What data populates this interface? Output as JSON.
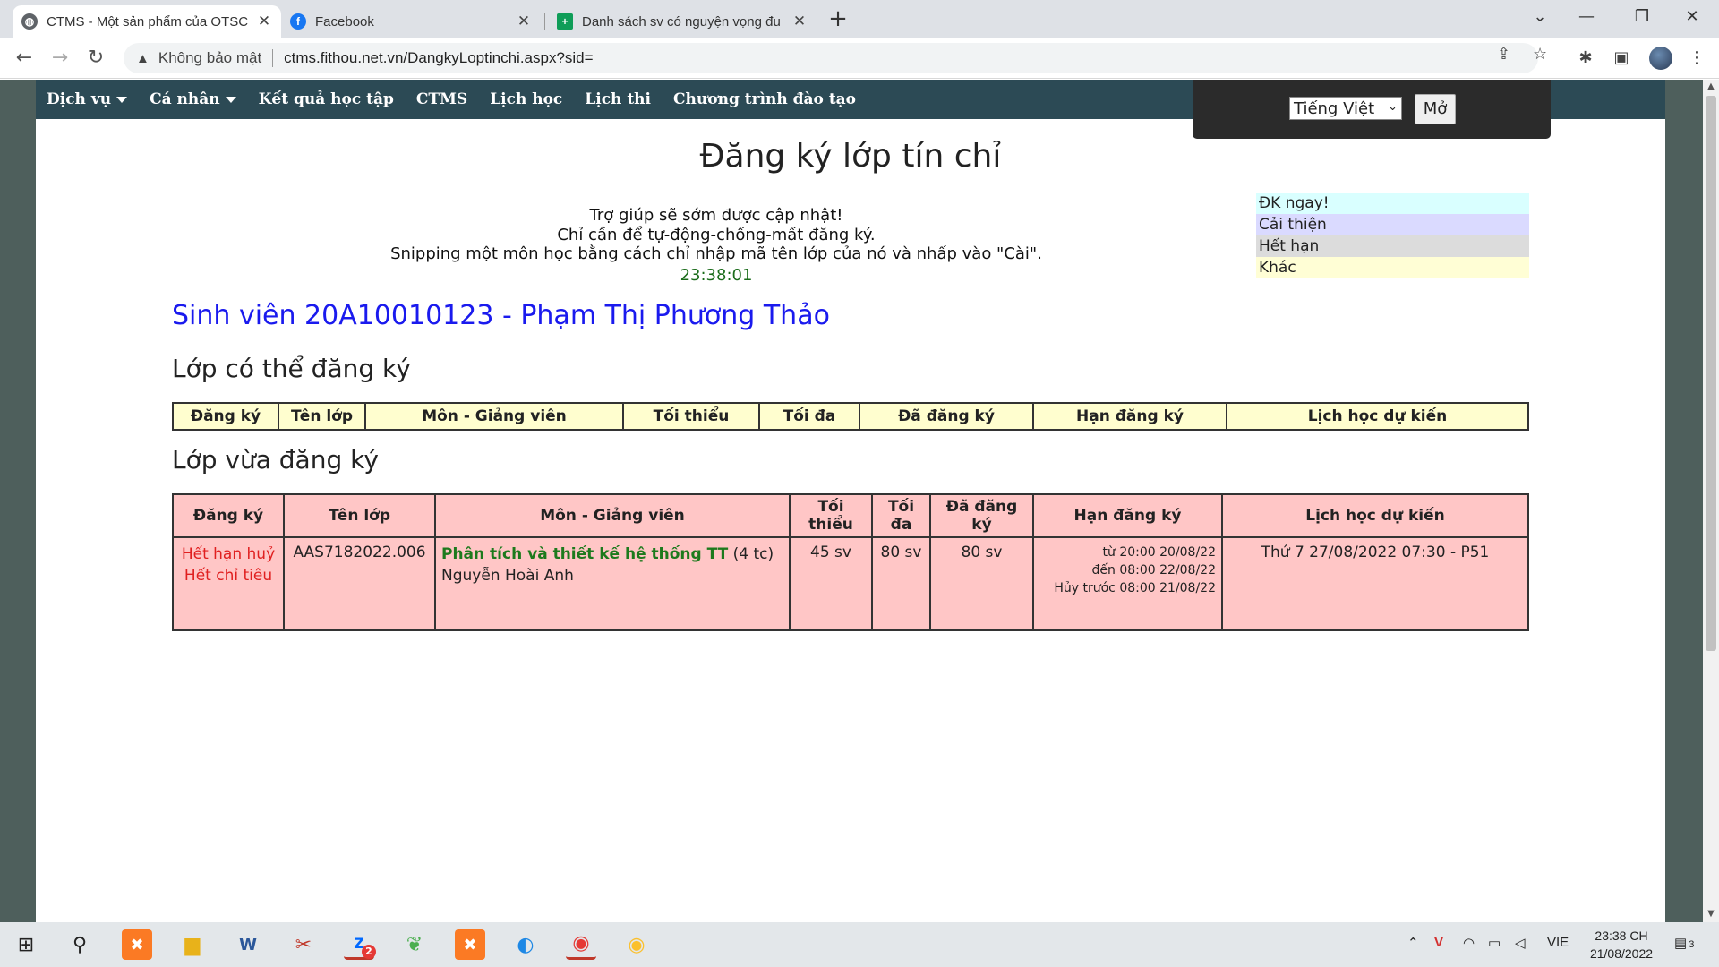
{
  "browser": {
    "tabs": [
      {
        "title": "CTMS - Một sản phẩm của OTSC",
        "icon": "globe-icon"
      },
      {
        "title": "Facebook",
        "icon": "facebook-icon"
      },
      {
        "title": "Danh sách sv có nguyện vọng đu",
        "icon": "sheets-icon"
      }
    ],
    "new_tab": "+",
    "address": {
      "security_label": "Không bảo mật",
      "url": "ctms.fithou.net.vn/DangkyLoptinchi.aspx?sid="
    }
  },
  "nav": {
    "items": [
      {
        "label": "Dịch vụ",
        "dropdown": true
      },
      {
        "label": "Cá nhân",
        "dropdown": true
      },
      {
        "label": "Kết quả học tập"
      },
      {
        "label": "CTMS"
      },
      {
        "label": "Lịch học"
      },
      {
        "label": "Lịch thi"
      },
      {
        "label": "Chương trình đào tạo"
      }
    ],
    "language": {
      "selected": "Tiếng Việt",
      "button": "Mở"
    }
  },
  "page": {
    "title": "Đăng ký lớp tín chỉ",
    "help": [
      "Trợ giúp sẽ sớm được cập nhật!",
      "Chỉ cần để tự-động-chống-mất đăng ký.",
      "Snipping một môn học bằng cách chỉ nhập mã tên lớp của nó và nhấp vào \"Cài\"."
    ],
    "clock": "23:38:01",
    "legend": [
      {
        "label": "ĐK ngay!",
        "color": "#d9ffff"
      },
      {
        "label": "Cải thiện",
        "color": "#dadaff"
      },
      {
        "label": "Hết hạn",
        "color": "#dcdcdc"
      },
      {
        "label": "Khác",
        "color": "#fffed5"
      }
    ],
    "student": "Sinh viên 20A10010123 - Phạm Thị Phương Thảo",
    "available_title": "Lớp có thể đăng ký",
    "registered_title": "Lớp vừa đăng ký"
  },
  "available_table": {
    "headers": [
      "Đăng ký",
      "Tên lớp",
      "Môn - Giảng viên",
      "Tối thiểu",
      "Tối đa",
      "Đã đăng ký",
      "Hạn đăng ký",
      "Lịch học dự kiến"
    ]
  },
  "registered_table": {
    "headers": [
      "Đăng ký",
      "Tên lớp",
      "Môn - Giảng viên",
      "Tối thiểu",
      "Tối đa",
      "Đã đăng ký",
      "Hạn đăng ký",
      "Lịch học dự kiến"
    ],
    "rows": [
      {
        "status1": "Hết hạn huỷ",
        "status2": "Hết chỉ tiêu",
        "class_name": "AAS7182022.006",
        "subject": "Phân tích và thiết kế hệ thống TT",
        "credits": "(4 tc)",
        "lecturer": "Nguyễn Hoài Anh",
        "min": "45 sv",
        "max": "80 sv",
        "registered": "80 sv",
        "deadline_from": "từ 20:00 20/08/22",
        "deadline_to": "đến 08:00 22/08/22",
        "cancel_before": "Hủy trước 08:00 21/08/22",
        "schedule": "Thứ 7 27/08/2022 07:30 - P51"
      }
    ]
  },
  "taskbar": {
    "tray_lang": "VIE",
    "time": "23:38 CH",
    "date": "21/08/2022",
    "zalo_badge": "2",
    "notifications": "3"
  }
}
